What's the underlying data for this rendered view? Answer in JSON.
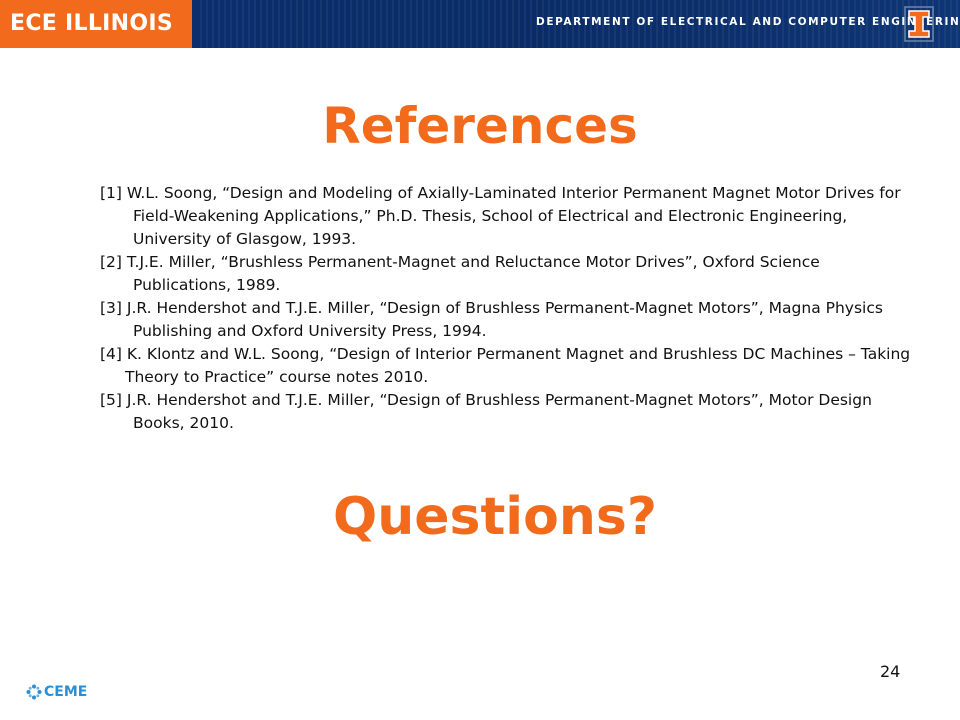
{
  "header": {
    "brand": "ECE ILLINOIS",
    "department": "DEPARTMENT OF ELECTRICAL AND COMPUTER ENGINEERING",
    "logo_icon": "block-i-icon"
  },
  "slide": {
    "title": "References",
    "references": [
      "[1] W.L. Soong, “Design and Modeling of Axially-Laminated Interior Permanent Magnet Motor Drives for Field-Weakening Applications,” Ph.D. Thesis, School of Electrical and Electronic Engineering, University of Glasgow, 1993.",
      "[2] T.J.E. Miller, “Brushless Permanent-Magnet and Reluctance Motor Drives”, Oxford Science Publications, 1989.",
      "[3] J.R. Hendershot and T.J.E. Miller, “Design of Brushless Permanent-Magnet Motors”, Magna Physics Publishing and Oxford University Press, 1994.",
      "[4] K. Klontz and W.L. Soong, “Design of Interior Permanent Magnet and Brushless DC Machines – Taking Theory to Practice” course notes 2010.",
      "[5] J.R. Hendershot and T.J.E. Miller, “Design of Brushless Permanent-Magnet Motors”, Motor Design Books, 2010."
    ],
    "closing": "Questions?"
  },
  "footer": {
    "logo_text": "CEME",
    "logo_icon": "ceme-logo-icon",
    "page_number": "24"
  },
  "colors": {
    "accent_orange": "#f26b1d",
    "header_navy": "#0a2b66",
    "ceme_blue": "#2b8fd1"
  }
}
